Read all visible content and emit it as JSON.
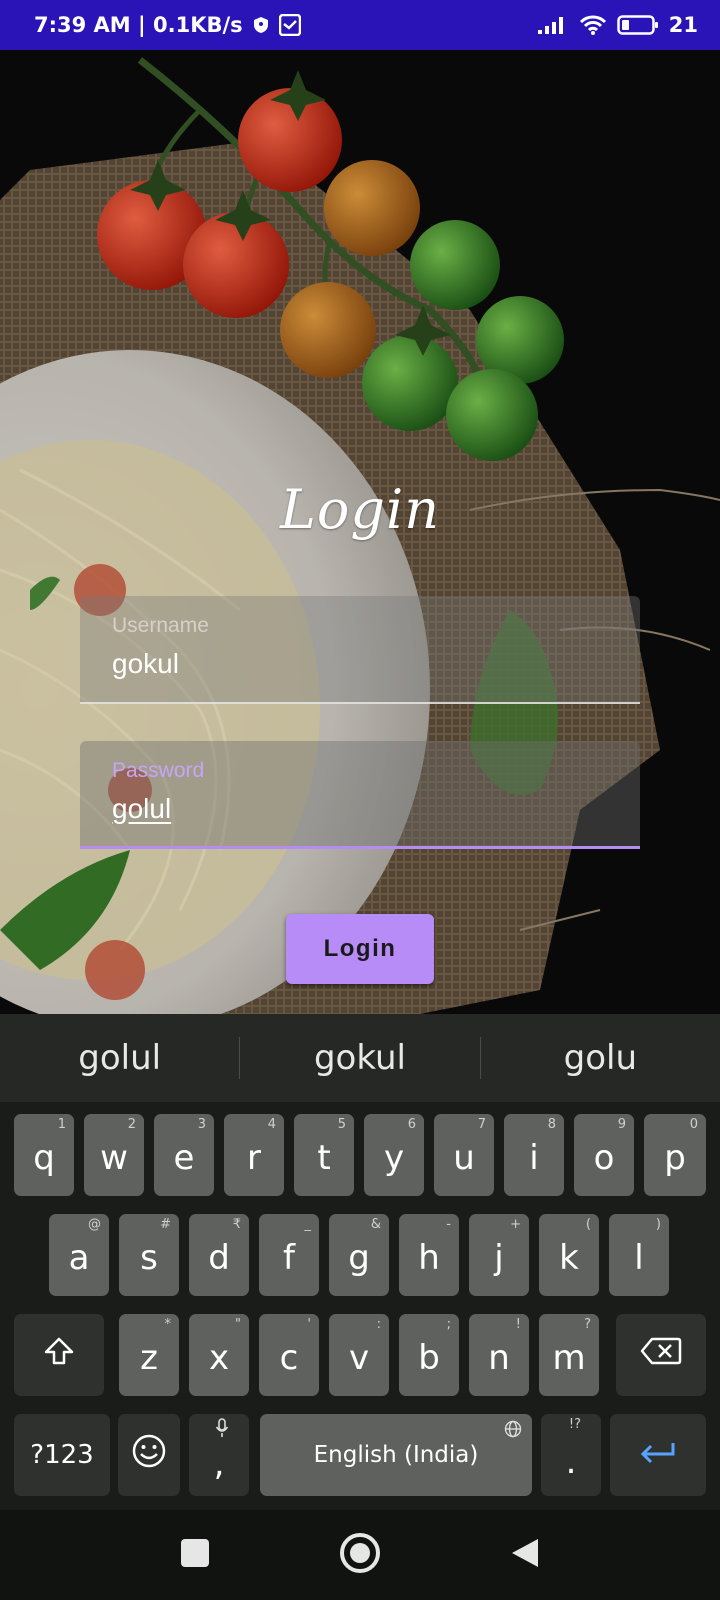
{
  "status_bar": {
    "time_speed": "7:39 AM | 0.1KB/s",
    "battery": "21"
  },
  "login": {
    "title": "Login",
    "username_label": "Username",
    "username_value": "gokul",
    "password_label": "Password",
    "password_value": "golul",
    "button_label": "Login"
  },
  "keyboard": {
    "suggestions": [
      "golul",
      "gokul",
      "golu"
    ],
    "row1": [
      {
        "key": "q",
        "hint": "1"
      },
      {
        "key": "w",
        "hint": "2"
      },
      {
        "key": "e",
        "hint": "3"
      },
      {
        "key": "r",
        "hint": "4"
      },
      {
        "key": "t",
        "hint": "5"
      },
      {
        "key": "y",
        "hint": "6"
      },
      {
        "key": "u",
        "hint": "7"
      },
      {
        "key": "i",
        "hint": "8"
      },
      {
        "key": "o",
        "hint": "9"
      },
      {
        "key": "p",
        "hint": "0"
      }
    ],
    "row2": [
      {
        "key": "a",
        "hint": "@"
      },
      {
        "key": "s",
        "hint": "#"
      },
      {
        "key": "d",
        "hint": "₹"
      },
      {
        "key": "f",
        "hint": "_"
      },
      {
        "key": "g",
        "hint": "&"
      },
      {
        "key": "h",
        "hint": "-"
      },
      {
        "key": "j",
        "hint": "+"
      },
      {
        "key": "k",
        "hint": "("
      },
      {
        "key": "l",
        "hint": ")"
      }
    ],
    "row3": [
      {
        "key": "z",
        "hint": "*"
      },
      {
        "key": "x",
        "hint": "\""
      },
      {
        "key": "c",
        "hint": "'"
      },
      {
        "key": "v",
        "hint": ":"
      },
      {
        "key": "b",
        "hint": ";"
      },
      {
        "key": "n",
        "hint": "!"
      },
      {
        "key": "m",
        "hint": "?"
      }
    ],
    "symbols_label": "?123",
    "comma_label": ",",
    "space_label": "English (India)",
    "period_label": ".",
    "period_hint": "!?"
  },
  "colors": {
    "status_bar": "#2a14b8",
    "accent": "#b88cf7",
    "key": "#5f615f",
    "key_dark": "#2f312f",
    "enter_icon": "#5aa2ff"
  },
  "icons": {
    "shift": "shift-icon",
    "backspace": "backspace-icon",
    "emoji": "emoji-icon",
    "enter": "enter-icon",
    "mic": "mic-icon",
    "globe": "globe-icon",
    "nav_recents": "square-icon",
    "nav_home": "circle-icon",
    "nav_back": "triangle-back-icon"
  }
}
